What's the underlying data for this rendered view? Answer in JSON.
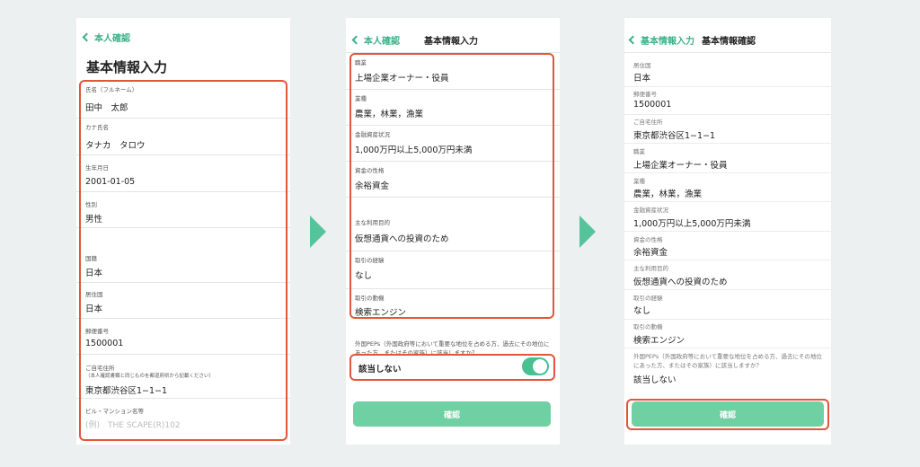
{
  "screen1": {
    "back_label": "本人確認",
    "title": "基本情報入力",
    "fields": [
      {
        "label": "氏名（フルネーム）",
        "value": "田中　太郎"
      },
      {
        "label": "カナ氏名",
        "value": "タナカ　タロウ"
      },
      {
        "label": "生年月日",
        "value": "2001-01-05"
      },
      {
        "label": "性別",
        "value": "男性"
      },
      {
        "label": "国籍",
        "value": "日本"
      },
      {
        "label": "居住国",
        "value": "日本"
      },
      {
        "label": "郵便番号",
        "value": "1500001"
      },
      {
        "label": "ご自宅住所",
        "note": "（本人確認書類と同じものを都道府県から記載ください）",
        "value": "東京都渋谷区1−1−1"
      },
      {
        "label": "ビル・マンション名等",
        "placeholder": "(例)　THE SCAPE(R)102"
      }
    ]
  },
  "screen2": {
    "back_label": "本人確認",
    "title": "基本情報入力",
    "fields": [
      {
        "label": "職業",
        "value": "上場企業オーナー・役員"
      },
      {
        "label": "業種",
        "value": "農業，林業，漁業"
      },
      {
        "label": "金融資産状況",
        "value": "1,000万円以上5,000万円未満"
      },
      {
        "label": "資金の性格",
        "value": "余裕資金"
      },
      {
        "label": "主な利用目的",
        "value": "仮想通貨への投資のため"
      },
      {
        "label": "取引の経験",
        "value": "なし"
      },
      {
        "label": "取引の動機",
        "value": "検索エンジン"
      }
    ],
    "pep_question": "外国PEPs（外国政府等において重要な地位を占める方、過去にその地位にあった方、またはその家族）に該当しますか？",
    "pep_answer": "該当しない",
    "pep_toggle_on": true,
    "confirm_button": "確認"
  },
  "screen3": {
    "back_label": "基本情報入力",
    "title": "基本情報確認",
    "fields": [
      {
        "label": "居住国",
        "value": "日本"
      },
      {
        "label": "郵便番号",
        "value": "1500001"
      },
      {
        "label": "ご自宅住所",
        "value": "東京都渋谷区1−1−1"
      },
      {
        "label": "職業",
        "value": "上場企業オーナー・役員"
      },
      {
        "label": "業種",
        "value": "農業，林業，漁業"
      },
      {
        "label": "金融資産状況",
        "value": "1,000万円以上5,000万円未満"
      },
      {
        "label": "資金の性格",
        "value": "余裕資金"
      },
      {
        "label": "主な利用目的",
        "value": "仮想通貨への投資のため"
      },
      {
        "label": "取引の経験",
        "value": "なし"
      },
      {
        "label": "取引の動機",
        "value": "検索エンジン"
      }
    ],
    "pep_question": "外国PEPs（外国政府等において重要な地位を占める方、過去にその地位にあった方、またはその家族）に該当しますか？",
    "pep_answer": "該当しない",
    "confirm_button": "確認"
  },
  "colors": {
    "accent": "#3bb187",
    "button": "#6fd0a3",
    "highlight": "#e2563b",
    "arrow": "#55c49a",
    "background": "#edf0f0"
  }
}
